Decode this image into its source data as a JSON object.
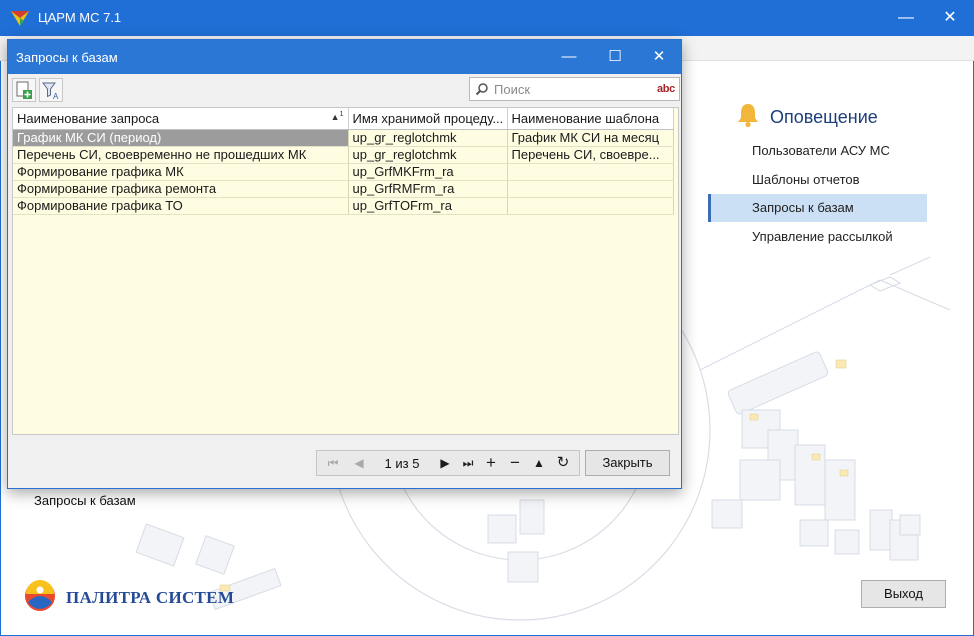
{
  "window": {
    "title": "ЦАРМ МС 7.1",
    "minimize_glyph": "—",
    "close_glyph": "✕"
  },
  "colors": {
    "titlebar": "#1f6fd6",
    "accent": "#3a6fb3",
    "grid_bg": "#fffde1",
    "brand": "#254a96"
  },
  "nav": {
    "section_title": "Оповещение",
    "section_icon": "bell-icon",
    "items": [
      {
        "label": "Пользователи АСУ МС",
        "active": false
      },
      {
        "label": "Шаблоны отчетов",
        "active": false
      },
      {
        "label": "Запросы к базам",
        "active": true
      },
      {
        "label": "Управление рассылкой",
        "active": false
      }
    ]
  },
  "current_section_label": "Запросы к базам",
  "brand": {
    "name": "ПАЛИТРА СИСТЕМ"
  },
  "exit_label": "Выход",
  "dialog": {
    "title": "Запросы к базам",
    "minimize_glyph": "—",
    "maximize_glyph": "☐",
    "close_glyph": "✕",
    "search": {
      "placeholder": "Поиск",
      "badge": "abc"
    },
    "columns": [
      "Наименование запроса",
      "Имя хранимой процеду...",
      "Наименование шаблона"
    ],
    "sort_mark": "▲",
    "sort_order": "1",
    "rows": [
      [
        "График МК СИ (период)",
        "up_gr_reglotchmk",
        "График МК СИ на месяц"
      ],
      [
        "Перечень СИ, своевременно не прошедших МК",
        "up_gr_reglotchmk",
        "Перечень СИ, своевре..."
      ],
      [
        "Формирование графика МК",
        "up_GrfMKFrm_ra",
        ""
      ],
      [
        "Формирование графика ремонта",
        "up_GrfRMFrm_ra",
        ""
      ],
      [
        "Формирование графика ТО",
        "up_GrfTOFrm_ra",
        ""
      ]
    ],
    "pager": {
      "page_info": "1 из 5",
      "first": "⏮",
      "prev": "◀",
      "next": "▶",
      "last": "⏭",
      "add": "+",
      "remove": "−",
      "up": "▲",
      "refresh": "↻"
    },
    "close_label": "Закрыть"
  }
}
